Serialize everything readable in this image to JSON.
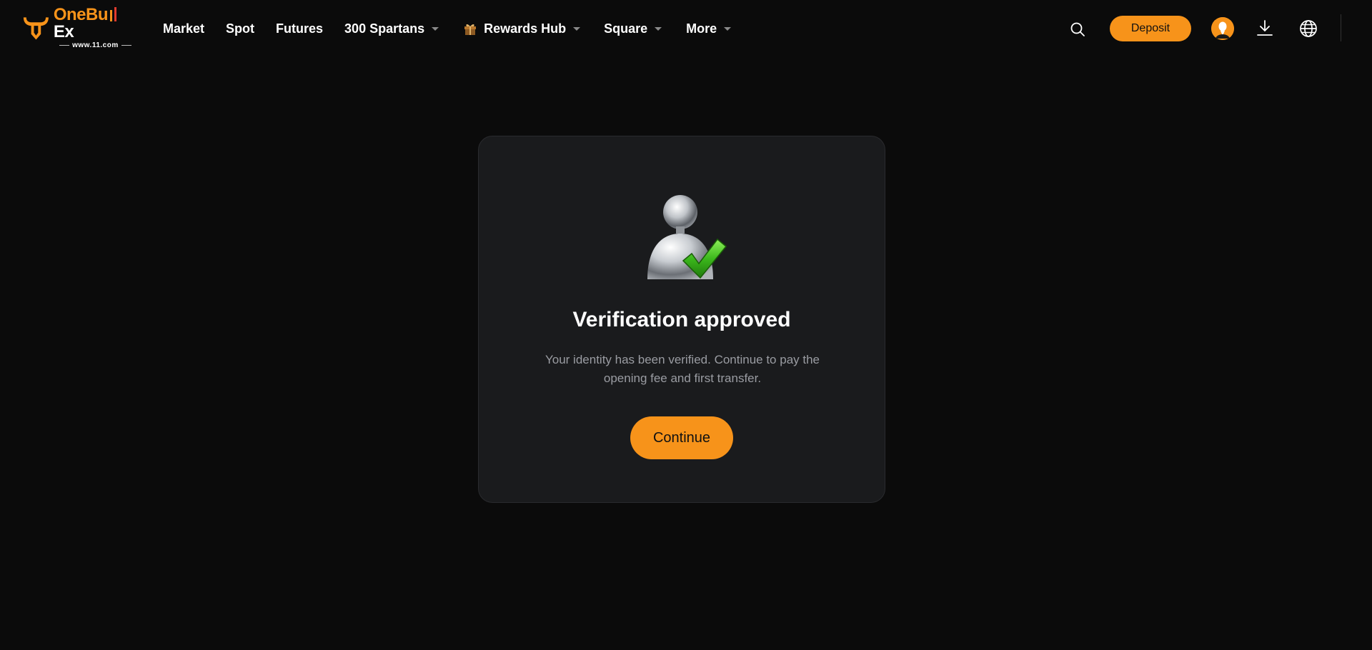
{
  "brand": {
    "name_part1": "One",
    "name_part2": "Bu",
    "name_part3": "Ex",
    "domain": "www.11.com",
    "accent_color": "#f7931a"
  },
  "nav": {
    "items": [
      {
        "label": "Market",
        "has_dropdown": false
      },
      {
        "label": "Spot",
        "has_dropdown": false
      },
      {
        "label": "Futures",
        "has_dropdown": false
      },
      {
        "label": "300 Spartans",
        "has_dropdown": true
      },
      {
        "label": "Rewards Hub",
        "has_dropdown": true,
        "icon": "gift-icon"
      },
      {
        "label": "Square",
        "has_dropdown": true
      },
      {
        "label": "More",
        "has_dropdown": true
      }
    ]
  },
  "toolbar": {
    "search_icon": "search-icon",
    "deposit_label": "Deposit",
    "avatar_icon": "user-avatar",
    "download_icon": "download-icon",
    "language_icon": "globe-icon"
  },
  "verification": {
    "illustration": "user-verified-icon",
    "title": "Verification approved",
    "description": "Your identity has been verified. Continue to pay the opening fee and first transfer.",
    "continue_label": "Continue"
  }
}
